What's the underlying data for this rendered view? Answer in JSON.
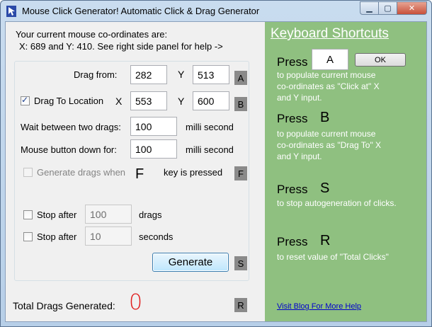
{
  "window": {
    "title": "Mouse Click Generator! Automatic Click & Drag Generator",
    "minimize_glyph": "▁",
    "maximize_glyph": "▢",
    "close_glyph": "✕"
  },
  "info": {
    "line1": "Your current mouse co-ordinates are:",
    "line2": "X: 689 and Y: 410. See right side panel for help ->"
  },
  "drag_from": {
    "label": "Drag from:",
    "x": "282",
    "y_label": "Y",
    "y": "513",
    "key": "A"
  },
  "drag_to": {
    "label": "Drag To Location",
    "checked": true,
    "x_label": "X",
    "x": "553",
    "y_label": "Y",
    "y": "600",
    "key": "B"
  },
  "wait": {
    "label": "Wait between two drags:",
    "value": "100",
    "unit": "milli second"
  },
  "button_down": {
    "label": "Mouse button down for:",
    "value": "100",
    "unit": "milli second"
  },
  "hotkey": {
    "label": "Generate drags when",
    "key_letter": "F",
    "suffix": "key is pressed",
    "badge": "F"
  },
  "stop_drags": {
    "label": "Stop after",
    "value": "100",
    "unit": "drags"
  },
  "stop_seconds": {
    "label": "Stop after",
    "value": "10",
    "unit": "seconds"
  },
  "generate": {
    "label": "Generate",
    "key": "S"
  },
  "total": {
    "label": "Total Drags Generated:",
    "value": "0",
    "key": "R"
  },
  "panel": {
    "title": "Keyboard Shortcuts",
    "press_word": "Press",
    "a_value": "A",
    "ok_label": "OK",
    "items": [
      {
        "key": "A",
        "desc_lines": [
          "to populate current mouse",
          "co-ordinates as \"Click at\" X",
          "and Y input."
        ]
      },
      {
        "key": "B",
        "desc_lines": [
          "to populate current mouse",
          "co-ordinates as \"Drag To\" X",
          "and Y input."
        ]
      },
      {
        "key": "S",
        "desc_lines": [
          "to stop autogeneration of clicks."
        ]
      },
      {
        "key": "R",
        "desc_lines": [
          "to reset value of \"Total Clicks\""
        ]
      }
    ],
    "blog_link": "Visit Blog For More Help"
  },
  "colors": {
    "panel_bg": "#8fc080",
    "counter_red": "#e01b1b",
    "badge_gray": "#8a8a8a"
  }
}
